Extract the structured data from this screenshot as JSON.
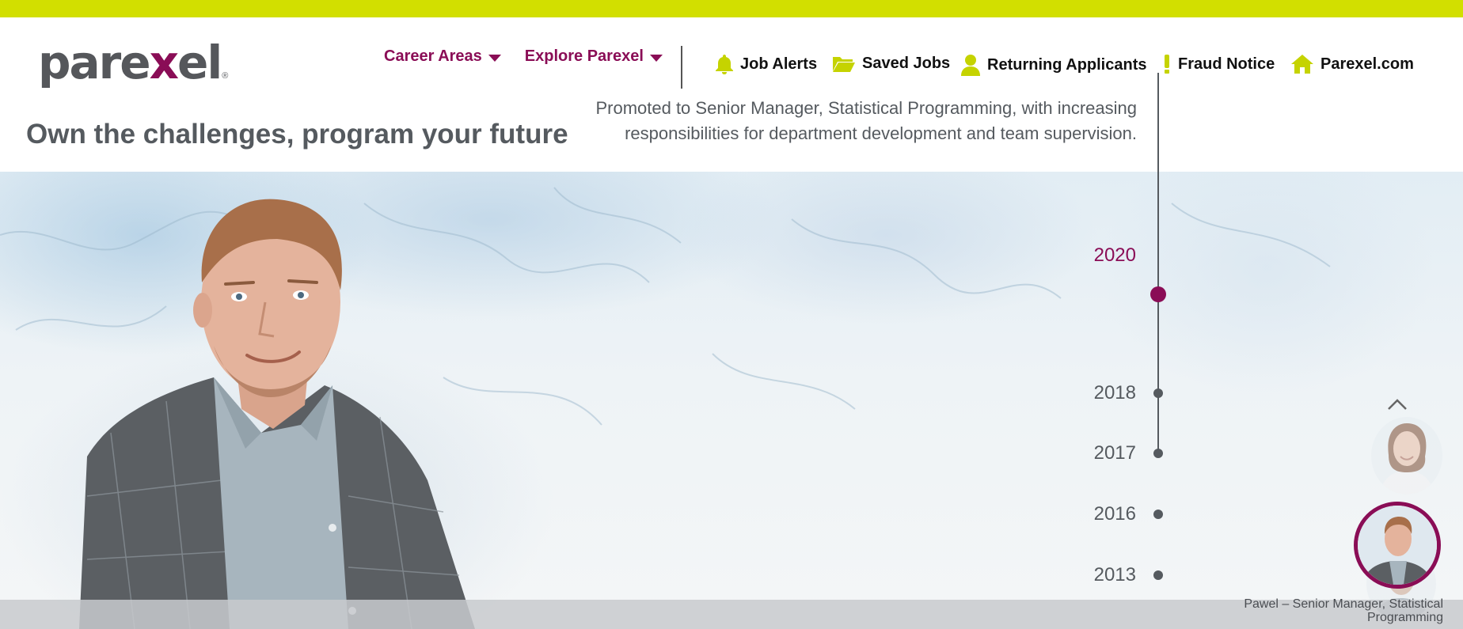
{
  "brand": {
    "logo_pre": "pare",
    "logo_x": "x",
    "logo_post": "el",
    "logo_reg": "®",
    "accent": "#8a0d56",
    "lime": "#d2df00"
  },
  "nav": {
    "career_areas": "Career Areas",
    "explore": "Explore Parexel"
  },
  "utility": {
    "job_alerts": "Job Alerts",
    "saved_jobs": "Saved Jobs",
    "returning": "Returning Applicants",
    "fraud": "Fraud Notice",
    "site": "Parexel.com"
  },
  "page": {
    "title": "Own the challenges, program your future"
  },
  "timeline": {
    "items": [
      {
        "year": "2020",
        "active": true
      },
      {
        "year": "2018",
        "active": false
      },
      {
        "year": "2017",
        "active": false
      },
      {
        "year": "2016",
        "active": false
      },
      {
        "year": "2013",
        "active": false
      }
    ],
    "active_description": "Promoted to Senior Manager, Statistical Programming, with increasing responsibilities for department development and team supervision."
  },
  "caption": {
    "text": "Pawel – Senior Manager, Statistical Programming"
  },
  "icons": {
    "job_alerts": "bell-icon",
    "saved_jobs": "folder-icon",
    "returning": "user-icon",
    "fraud": "exclamation-icon",
    "site": "home-icon",
    "scroll_up": "chevron-up-icon"
  }
}
